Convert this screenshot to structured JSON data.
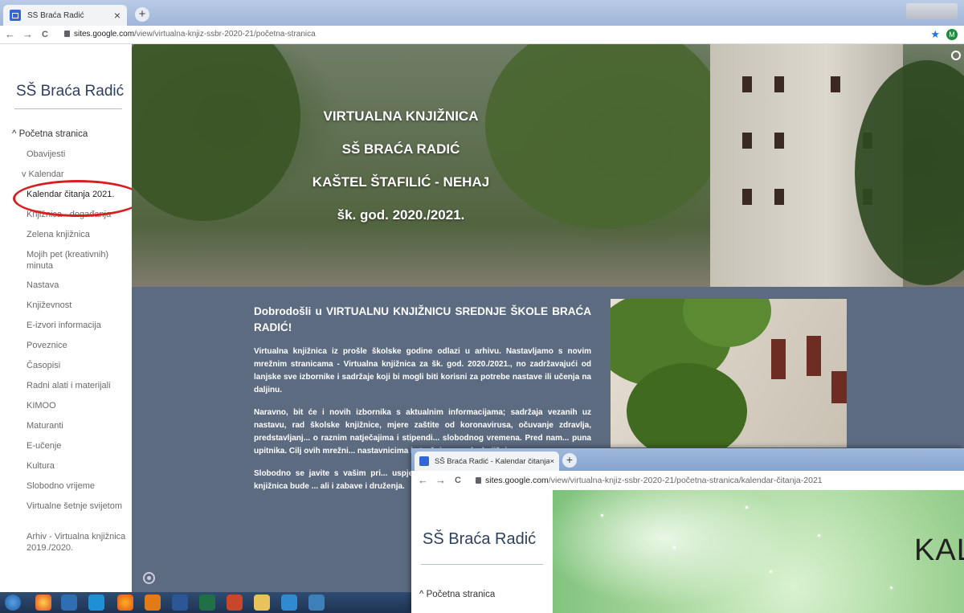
{
  "browser": {
    "tab_title": "SŠ Braća Radić",
    "tab_close": "×",
    "new_tab": "+",
    "back": "←",
    "forward": "→",
    "reload": "C",
    "url_domain": "sites.google.com",
    "url_path": "/view/virtualna-knjiz-ssbr-2020-21/početna-stranica",
    "star": "★",
    "account_initial": "M"
  },
  "sidebar": {
    "site_title": "SŠ Braća Radić",
    "items": [
      {
        "label": "^ Početna stranica",
        "level": "top"
      },
      {
        "label": "Obavijesti",
        "level": "child"
      },
      {
        "label": "v Kalendar",
        "level": "sub"
      },
      {
        "label": "Kalendar čitanja 2021.",
        "level": "child"
      },
      {
        "label": "Knjižnica - događanja",
        "level": "child"
      },
      {
        "label": "Zelena knjižnica",
        "level": "child"
      },
      {
        "label": "Mojih pet (kreativnih) minuta",
        "level": "child"
      },
      {
        "label": "Nastava",
        "level": "child"
      },
      {
        "label": "Književnost",
        "level": "child"
      },
      {
        "label": "E-izvori informacija",
        "level": "child"
      },
      {
        "label": "Poveznice",
        "level": "child"
      },
      {
        "label": "Časopisi",
        "level": "child"
      },
      {
        "label": "Radni alati i materijali",
        "level": "child"
      },
      {
        "label": "KIMOO",
        "level": "child"
      },
      {
        "label": "Maturanti",
        "level": "child"
      },
      {
        "label": "E-učenje",
        "level": "child"
      },
      {
        "label": "Kultura",
        "level": "child"
      },
      {
        "label": "Slobodno vrijeme",
        "level": "child"
      },
      {
        "label": "Virtualne šetnje svijetom",
        "level": "child"
      },
      {
        "label": "Arhiv - Virtualna knjižnica 2019./2020.",
        "level": "child"
      }
    ]
  },
  "hero": {
    "line1": "VIRTUALNA KNJIŽNICA",
    "line2": "SŠ BRAĆA RADIĆ",
    "line3": "KAŠTEL ŠTAFILIĆ - NEHAJ",
    "line4": "šk. god. 2020./2021."
  },
  "main": {
    "heading": "Dobrodošli u VIRTUALNU KNJIŽNICU SREDNJE ŠKOLE BRAĆA RADIĆ!",
    "p1": "Virtualna knjižnica iz prošle školske godine odlazi u arhivu. Nastavljamo s novim mrežnim stranicama - Virtualna knjižnica za šk. god. 2020./2021., no zadržavajući od lanjske sve izbornike i sadržaje koji bi mogli biti korisni za potrebe nastave ili učenja na daljinu.",
    "p2": "Naravno, bit će i novih izbornika s aktualnim informacijama; sadržaja vezanih uz nastavu, rad školske knjižnice, mjere zaštite od koronavirusa, očuvanje zdravlja, predstavljanj... o raznim natječajima i stipendi... slobodnog vremena. Pred nam... puna upitnika. Cilj ovih mrežni... nastavnicima i stručnim surad... knjižnice.",
    "p3": "Slobodno se javite s vašim pri... uspješne školske ili izvanškolsk... Neka Virtualna knjižnica bude ... ali i zabave i druženja."
  },
  "overlay_window": {
    "tab_title": "SŠ Braća Radić - Kalendar čitanja",
    "tab_close": "×",
    "new_tab": "+",
    "back": "←",
    "forward": "→",
    "reload": "C",
    "url_domain": "sites.google.com",
    "url_path": "/view/virtualna-knjiz-ssbr-2020-21/početna-stranica/kalendar-čitanja-2021",
    "site_title": "SŠ Braća Radić",
    "nav_item": "^ Početna stranica",
    "hero_text": "KALE"
  },
  "colors": {
    "page_bg": "#5d6b80",
    "title_blue": "#2e4060",
    "highlight_red": "#d71f1f"
  }
}
